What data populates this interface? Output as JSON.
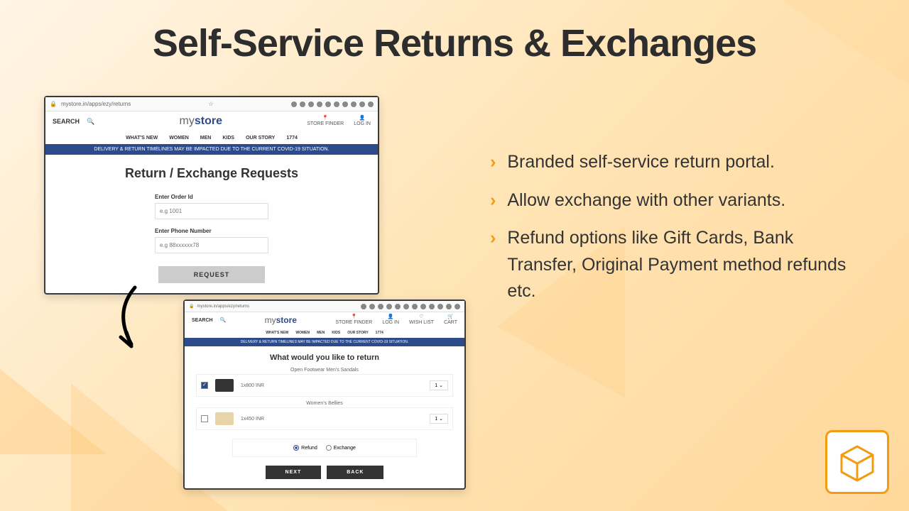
{
  "title": "Self-Service Returns & Exchanges",
  "bullets": [
    "Branded self-service return portal.",
    "Allow exchange with other variants.",
    "Refund options like Gift Cards, Bank Transfer, Original Payment method refunds etc."
  ],
  "browser1": {
    "url": "mystore.in/apps/ezy/returns",
    "search": "SEARCH",
    "logo_prefix": "my",
    "logo_bold": "store",
    "actions": [
      "STORE FINDER",
      "LOG IN"
    ],
    "nav": [
      "WHAT'S NEW",
      "WOMEN",
      "MEN",
      "KIDS",
      "OUR STORY",
      "1774"
    ],
    "banner": "DELIVERY & RETURN TIMELINES MAY BE IMPACTED DUE TO THE CURRENT COVID-19 SITUATION.",
    "page_title": "Return / Exchange Requests",
    "order_label": "Enter Order Id",
    "order_placeholder": "e.g 1001",
    "phone_label": "Enter Phone Number",
    "phone_placeholder": "e.g 88xxxxxx78",
    "button": "REQUEST"
  },
  "browser2": {
    "url": "mystore.in/apps/ezy/returns",
    "search": "SEARCH",
    "actions": [
      "STORE FINDER",
      "LOG IN",
      "WISH LIST",
      "CART"
    ],
    "nav": [
      "WHAT'S NEW",
      "WOMEN",
      "MEN",
      "KIDS",
      "OUR STORY",
      "1774"
    ],
    "banner": "DELIVERY & RETURN TIMELINES MAY BE IMPACTED DUE TO THE CURRENT COVID-19 SITUATION.",
    "page_title": "What would you like to return",
    "items": [
      {
        "name": "Open Footwear Men's Sandals",
        "price": "1x800 INR",
        "qty": "1",
        "checked": true
      },
      {
        "name": "Women's Bellies",
        "price": "1x450 INR",
        "qty": "1",
        "checked": false
      }
    ],
    "radio": {
      "refund": "Refund",
      "exchange": "Exchange"
    },
    "next": "NEXT",
    "back": "BACK"
  }
}
